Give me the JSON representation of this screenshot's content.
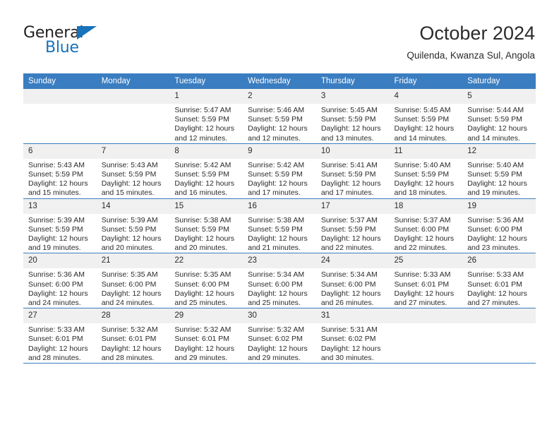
{
  "brand": {
    "word_one": "General",
    "word_two": "Blue",
    "accent_color": "#1673bc"
  },
  "header": {
    "title": "October 2024",
    "subtitle": "Quilenda, Kwanza Sul, Angola"
  },
  "theme": {
    "header_blue": "#3a7dc0",
    "daynum_gray": "#f0f0f0",
    "text": "#2b2b2b"
  },
  "labels": {
    "sunrise_prefix": "Sunrise:",
    "sunset_prefix": "Sunset:",
    "daylight_prefix": "Daylight:"
  },
  "weekday_headers": [
    "Sunday",
    "Monday",
    "Tuesday",
    "Wednesday",
    "Thursday",
    "Friday",
    "Saturday"
  ],
  "weeks": [
    [
      {
        "day": "",
        "empty": true
      },
      {
        "day": "",
        "empty": true
      },
      {
        "day": "1",
        "sunrise": "Sunrise: 5:47 AM",
        "sunset": "Sunset: 5:59 PM",
        "daylight_line1": "Daylight: 12 hours",
        "daylight_line2": "and 12 minutes."
      },
      {
        "day": "2",
        "sunrise": "Sunrise: 5:46 AM",
        "sunset": "Sunset: 5:59 PM",
        "daylight_line1": "Daylight: 12 hours",
        "daylight_line2": "and 12 minutes."
      },
      {
        "day": "3",
        "sunrise": "Sunrise: 5:45 AM",
        "sunset": "Sunset: 5:59 PM",
        "daylight_line1": "Daylight: 12 hours",
        "daylight_line2": "and 13 minutes."
      },
      {
        "day": "4",
        "sunrise": "Sunrise: 5:45 AM",
        "sunset": "Sunset: 5:59 PM",
        "daylight_line1": "Daylight: 12 hours",
        "daylight_line2": "and 14 minutes."
      },
      {
        "day": "5",
        "sunrise": "Sunrise: 5:44 AM",
        "sunset": "Sunset: 5:59 PM",
        "daylight_line1": "Daylight: 12 hours",
        "daylight_line2": "and 14 minutes."
      }
    ],
    [
      {
        "day": "6",
        "sunrise": "Sunrise: 5:43 AM",
        "sunset": "Sunset: 5:59 PM",
        "daylight_line1": "Daylight: 12 hours",
        "daylight_line2": "and 15 minutes."
      },
      {
        "day": "7",
        "sunrise": "Sunrise: 5:43 AM",
        "sunset": "Sunset: 5:59 PM",
        "daylight_line1": "Daylight: 12 hours",
        "daylight_line2": "and 15 minutes."
      },
      {
        "day": "8",
        "sunrise": "Sunrise: 5:42 AM",
        "sunset": "Sunset: 5:59 PM",
        "daylight_line1": "Daylight: 12 hours",
        "daylight_line2": "and 16 minutes."
      },
      {
        "day": "9",
        "sunrise": "Sunrise: 5:42 AM",
        "sunset": "Sunset: 5:59 PM",
        "daylight_line1": "Daylight: 12 hours",
        "daylight_line2": "and 17 minutes."
      },
      {
        "day": "10",
        "sunrise": "Sunrise: 5:41 AM",
        "sunset": "Sunset: 5:59 PM",
        "daylight_line1": "Daylight: 12 hours",
        "daylight_line2": "and 17 minutes."
      },
      {
        "day": "11",
        "sunrise": "Sunrise: 5:40 AM",
        "sunset": "Sunset: 5:59 PM",
        "daylight_line1": "Daylight: 12 hours",
        "daylight_line2": "and 18 minutes."
      },
      {
        "day": "12",
        "sunrise": "Sunrise: 5:40 AM",
        "sunset": "Sunset: 5:59 PM",
        "daylight_line1": "Daylight: 12 hours",
        "daylight_line2": "and 19 minutes."
      }
    ],
    [
      {
        "day": "13",
        "sunrise": "Sunrise: 5:39 AM",
        "sunset": "Sunset: 5:59 PM",
        "daylight_line1": "Daylight: 12 hours",
        "daylight_line2": "and 19 minutes."
      },
      {
        "day": "14",
        "sunrise": "Sunrise: 5:39 AM",
        "sunset": "Sunset: 5:59 PM",
        "daylight_line1": "Daylight: 12 hours",
        "daylight_line2": "and 20 minutes."
      },
      {
        "day": "15",
        "sunrise": "Sunrise: 5:38 AM",
        "sunset": "Sunset: 5:59 PM",
        "daylight_line1": "Daylight: 12 hours",
        "daylight_line2": "and 20 minutes."
      },
      {
        "day": "16",
        "sunrise": "Sunrise: 5:38 AM",
        "sunset": "Sunset: 5:59 PM",
        "daylight_line1": "Daylight: 12 hours",
        "daylight_line2": "and 21 minutes."
      },
      {
        "day": "17",
        "sunrise": "Sunrise: 5:37 AM",
        "sunset": "Sunset: 5:59 PM",
        "daylight_line1": "Daylight: 12 hours",
        "daylight_line2": "and 22 minutes."
      },
      {
        "day": "18",
        "sunrise": "Sunrise: 5:37 AM",
        "sunset": "Sunset: 6:00 PM",
        "daylight_line1": "Daylight: 12 hours",
        "daylight_line2": "and 22 minutes."
      },
      {
        "day": "19",
        "sunrise": "Sunrise: 5:36 AM",
        "sunset": "Sunset: 6:00 PM",
        "daylight_line1": "Daylight: 12 hours",
        "daylight_line2": "and 23 minutes."
      }
    ],
    [
      {
        "day": "20",
        "sunrise": "Sunrise: 5:36 AM",
        "sunset": "Sunset: 6:00 PM",
        "daylight_line1": "Daylight: 12 hours",
        "daylight_line2": "and 24 minutes."
      },
      {
        "day": "21",
        "sunrise": "Sunrise: 5:35 AM",
        "sunset": "Sunset: 6:00 PM",
        "daylight_line1": "Daylight: 12 hours",
        "daylight_line2": "and 24 minutes."
      },
      {
        "day": "22",
        "sunrise": "Sunrise: 5:35 AM",
        "sunset": "Sunset: 6:00 PM",
        "daylight_line1": "Daylight: 12 hours",
        "daylight_line2": "and 25 minutes."
      },
      {
        "day": "23",
        "sunrise": "Sunrise: 5:34 AM",
        "sunset": "Sunset: 6:00 PM",
        "daylight_line1": "Daylight: 12 hours",
        "daylight_line2": "and 25 minutes."
      },
      {
        "day": "24",
        "sunrise": "Sunrise: 5:34 AM",
        "sunset": "Sunset: 6:00 PM",
        "daylight_line1": "Daylight: 12 hours",
        "daylight_line2": "and 26 minutes."
      },
      {
        "day": "25",
        "sunrise": "Sunrise: 5:33 AM",
        "sunset": "Sunset: 6:01 PM",
        "daylight_line1": "Daylight: 12 hours",
        "daylight_line2": "and 27 minutes."
      },
      {
        "day": "26",
        "sunrise": "Sunrise: 5:33 AM",
        "sunset": "Sunset: 6:01 PM",
        "daylight_line1": "Daylight: 12 hours",
        "daylight_line2": "and 27 minutes."
      }
    ],
    [
      {
        "day": "27",
        "sunrise": "Sunrise: 5:33 AM",
        "sunset": "Sunset: 6:01 PM",
        "daylight_line1": "Daylight: 12 hours",
        "daylight_line2": "and 28 minutes."
      },
      {
        "day": "28",
        "sunrise": "Sunrise: 5:32 AM",
        "sunset": "Sunset: 6:01 PM",
        "daylight_line1": "Daylight: 12 hours",
        "daylight_line2": "and 28 minutes."
      },
      {
        "day": "29",
        "sunrise": "Sunrise: 5:32 AM",
        "sunset": "Sunset: 6:01 PM",
        "daylight_line1": "Daylight: 12 hours",
        "daylight_line2": "and 29 minutes."
      },
      {
        "day": "30",
        "sunrise": "Sunrise: 5:32 AM",
        "sunset": "Sunset: 6:02 PM",
        "daylight_line1": "Daylight: 12 hours",
        "daylight_line2": "and 29 minutes."
      },
      {
        "day": "31",
        "sunrise": "Sunrise: 5:31 AM",
        "sunset": "Sunset: 6:02 PM",
        "daylight_line1": "Daylight: 12 hours",
        "daylight_line2": "and 30 minutes."
      },
      {
        "day": "",
        "empty": true
      },
      {
        "day": "",
        "empty": true
      }
    ]
  ]
}
